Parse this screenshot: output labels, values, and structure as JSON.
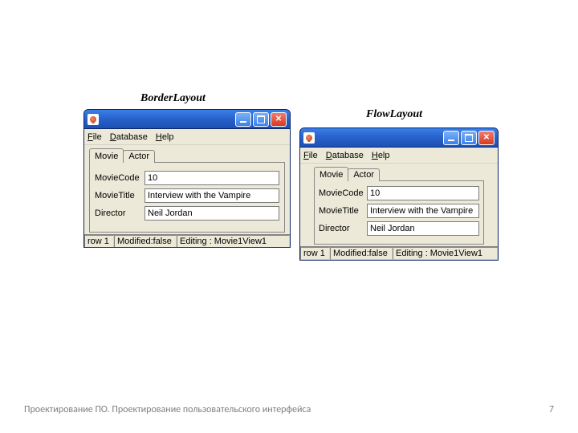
{
  "captions": {
    "border": "BorderLayout",
    "flow": "FlowLayout"
  },
  "menu": {
    "file": "File",
    "file_u": "F",
    "database": "Database",
    "database_u": "D",
    "help": "Help",
    "help_u": "H"
  },
  "tabs": {
    "movie": "Movie",
    "actor": "Actor"
  },
  "fields": {
    "code_label": "MovieCode",
    "code_value": "10",
    "title_label": "MovieTitle",
    "title_value": "Interview with the Vampire",
    "director_label": "Director",
    "director_value": "Neil Jordan"
  },
  "status": {
    "row": "row 1",
    "modified": "Modified:false",
    "editing": "Editing : Movie1View1"
  },
  "footer": {
    "text": "Проектирование ПО. Проектирование пользовательского интерфейса",
    "page": "7"
  }
}
